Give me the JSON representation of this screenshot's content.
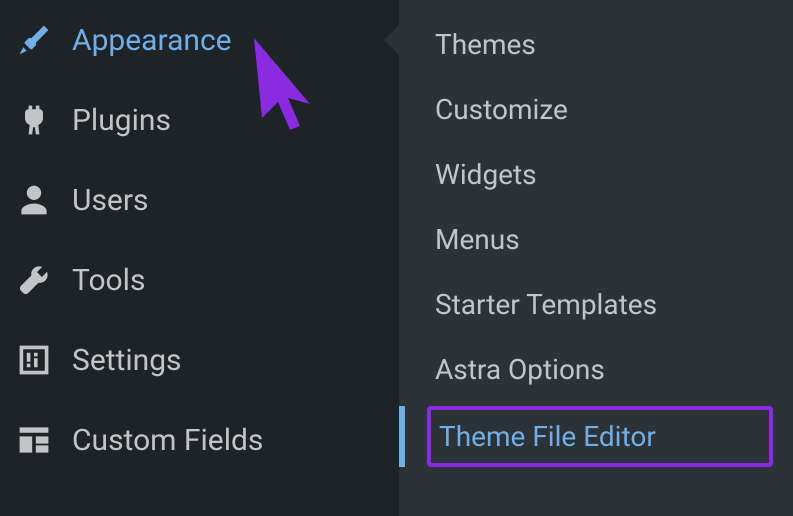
{
  "sidebar": {
    "items": [
      {
        "label": "Appearance",
        "icon": "brush-icon",
        "active": true
      },
      {
        "label": "Plugins",
        "icon": "plug-icon",
        "active": false
      },
      {
        "label": "Users",
        "icon": "user-icon",
        "active": false
      },
      {
        "label": "Tools",
        "icon": "wrench-icon",
        "active": false
      },
      {
        "label": "Settings",
        "icon": "sliders-icon",
        "active": false
      },
      {
        "label": "Custom Fields",
        "icon": "grid-icon",
        "active": false
      }
    ]
  },
  "submenu": {
    "items": [
      {
        "label": "Themes"
      },
      {
        "label": "Customize"
      },
      {
        "label": "Widgets"
      },
      {
        "label": "Menus"
      },
      {
        "label": "Starter Templates"
      },
      {
        "label": "Astra Options"
      },
      {
        "label": "Theme File Editor",
        "highlighted": true
      }
    ]
  },
  "annotation": {
    "cursor_color": "#8a2be2",
    "highlight_color": "#8a2be2"
  }
}
